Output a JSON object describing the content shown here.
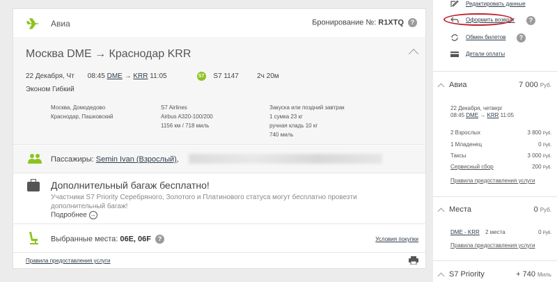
{
  "header": {
    "section_title": "Авиа",
    "booking_label": "Бронирование №:",
    "booking_code": "R1XTQ",
    "help": "?"
  },
  "flight": {
    "route_from": "Москва DME",
    "route_arrow": "→",
    "route_to": "Краснодар KRR",
    "date": "22 Декабря, Чт",
    "dep_time": "08:45",
    "dep_code": "DME",
    "arrow": "→",
    "arr_code": "KRR",
    "arr_time": "11:05",
    "airline_badge": "S7",
    "flight_no": "S7 1147",
    "duration": "2ч 20м",
    "fare": "Эконом Гибкий",
    "col1": [
      "Москва, Домодедово",
      "Краснодар, Пашковский"
    ],
    "col2": [
      "S7 Airlines",
      "Airbus A320-100/200",
      "1156 км / 718 миль"
    ],
    "col3": [
      "Закуска или поздний завтрак",
      "1 сумка 23 кг",
      "ручная кладь 10 кг",
      "740 миль"
    ]
  },
  "passengers": {
    "label": "Пассажиры:",
    "name": "Semin Ivan (Взрослый)",
    "separator": ","
  },
  "baggage": {
    "title": "Дополнительный багаж бесплатно!",
    "description": "Участники S7 Priority Серебряного, Золотого и Платинового статуса могут бесплатно провезти дополнительный багаж!",
    "more": "Подробнее",
    "more_icon": "→"
  },
  "seats": {
    "label": "Выбранные места:",
    "value": "06E, 06F",
    "help": "?",
    "conditions": "Условия покупки"
  },
  "footer": {
    "rules": "Правила предоставления услуги"
  },
  "sidebar": {
    "actions": [
      {
        "icon": "edit-icon",
        "label": "Редактировать данные"
      },
      {
        "icon": "undo-icon",
        "label": "Оформить возврат",
        "help": "?"
      },
      {
        "icon": "exchange-icon",
        "label": "Обмен билетов",
        "help": "?"
      },
      {
        "icon": "card-icon",
        "label": "Детали оплаты"
      }
    ],
    "avia": {
      "title": "Авиа",
      "price": "7 000",
      "currency": "Руб.",
      "date": "22 Декабря, четверг",
      "times_pre": "08:45",
      "times_dep": "DME",
      "times_arrow": "→",
      "times_arr": "KRR",
      "times_post": "11:05",
      "lines": [
        {
          "label": "2 Взрослых",
          "value": "3 800",
          "unit": "Руб."
        },
        {
          "label": "1 Младенец",
          "value": "0",
          "unit": "Руб."
        },
        {
          "label": "Таксы",
          "value": "3 000",
          "unit": "Руб."
        },
        {
          "label": "Сервисный сбор",
          "value": "200",
          "unit": "Руб."
        }
      ],
      "rules": "Правила предоставления услуги"
    },
    "seats": {
      "title": "Места",
      "price": "0",
      "currency": "Руб.",
      "route": "DME - KRR",
      "count": "2 места",
      "value": "0",
      "unit": "Руб.",
      "rules": "Правила предоставления услуги"
    },
    "priority": {
      "title": "S7 Priority",
      "value": "+ 740",
      "unit": "Миль"
    }
  },
  "colors": {
    "accent": "#8cc31f",
    "highlight": "#c0202a"
  }
}
